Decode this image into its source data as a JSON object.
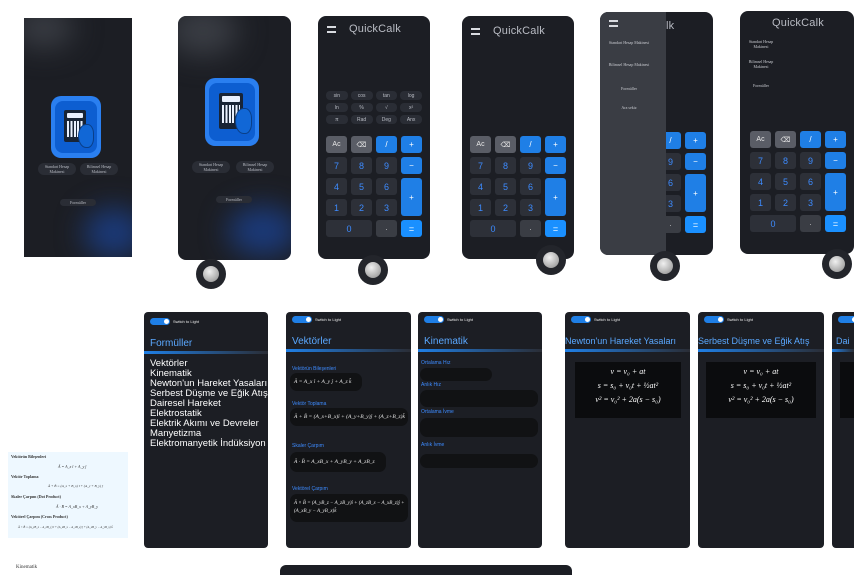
{
  "app": {
    "title": "QuickCalk"
  },
  "home": {
    "btn_standard": "Standart Hesap Makinesi",
    "btn_scientific": "Bilimsel Hesap Makinesi",
    "btn_formulas": "Formüller"
  },
  "calc": {
    "sci_keys": [
      "sin",
      "cos",
      "tan",
      "log",
      "ln",
      "%",
      "√",
      "x²",
      "π",
      "Rad",
      "Deg",
      "Anx"
    ],
    "clear": "Ac",
    "backspace": "⌫",
    "ops": [
      "/",
      "+",
      "−",
      "+",
      "="
    ],
    "digits": [
      "7",
      "8",
      "9",
      "4",
      "5",
      "6",
      "1",
      "2",
      "3",
      "0",
      "."
    ]
  },
  "drawer": {
    "items": [
      "Standart Hesap Makinesi",
      "Bilimsel Hesap Makinesi",
      "Formüller",
      "Ara sekiz"
    ]
  },
  "formulas": {
    "toggle_label": "Switch to Light",
    "title": "Formüller",
    "topics": [
      "Vektörler",
      "Kinematik",
      "Newton'un Hareket Yasaları",
      "Serbest Düşme ve Eğik Atış",
      "Dairesel Hareket",
      "Elektrostatik",
      "Elektrik Akımı ve Devreler",
      "Manyetizma",
      "Elektromanyetik İndüksiyon"
    ]
  },
  "vectors": {
    "title": "Vektörler",
    "sections": [
      {
        "label": "Vektörün Bileşenleri",
        "formula": "Ā = A_x î + A_y ĵ + A_z k̂"
      },
      {
        "label": "Vektör Toplama",
        "formula": "Ā + B̄ = (A_x+B_x)î + (A_y+B_y)ĵ + (A_z+B_z)k̂"
      },
      {
        "label": "Skaler Çarpım",
        "formula": "Ā · B̄ = A_xB_x + A_yB_y + A_zB_z"
      },
      {
        "label": "Vektörel Çarpım",
        "formula": "Ā × B̄ = (A_yB_z − A_zB_y)î + (A_zB_x − A_xB_z)ĵ + (A_xB_y − A_yB_x)k̂"
      }
    ]
  },
  "kinematics": {
    "title": "Kinematik",
    "labels": [
      "Ortalama Hız",
      "Anlık Hız",
      "Ortalama İvme",
      "Anlık İvme"
    ]
  },
  "newton": {
    "title": "Newton'un Hareket Yasaları",
    "eqs": [
      "v = v₀ + at",
      "s = s₀ + v₀t + ½at²",
      "v² = v₀² + 2a(s − s₀)"
    ]
  },
  "freefall": {
    "title": "Serbest Düşme ve Eğik Atış",
    "eqs": [
      "v = v₀ + at",
      "s = s₀ + v₀t + ½at²",
      "v² = v₀² + 2a(s − s₀)"
    ]
  },
  "circular": {
    "title": "Dai"
  },
  "doc": {
    "rows": [
      {
        "label": "Vektörün Bileşenleri",
        "eq": "Ā = A_x î + A_y ĵ"
      },
      {
        "label": "Vektör Toplama",
        "eq": "Ā + B̄ = (A_x + B_x) î + (A_y + B_y) ĵ"
      },
      {
        "label": "Skaler Çarpım (Dot Product)",
        "eq": "Ā · B̄ = A_xB_x + A_yB_y"
      },
      {
        "label": "Vektörel Çarpım (Cross Product)",
        "eq": "Ā × B̄ = (A_yB_z − A_zB_y) î + (A_zB_x − A_xB_z) ĵ + (A_xB_y − A_yB_x) k̂"
      }
    ],
    "footer": "Kinematik"
  },
  "colors": {
    "accent": "#1f7fe6",
    "background": "#1c1e24",
    "title_blue": "#5aa8ff"
  }
}
